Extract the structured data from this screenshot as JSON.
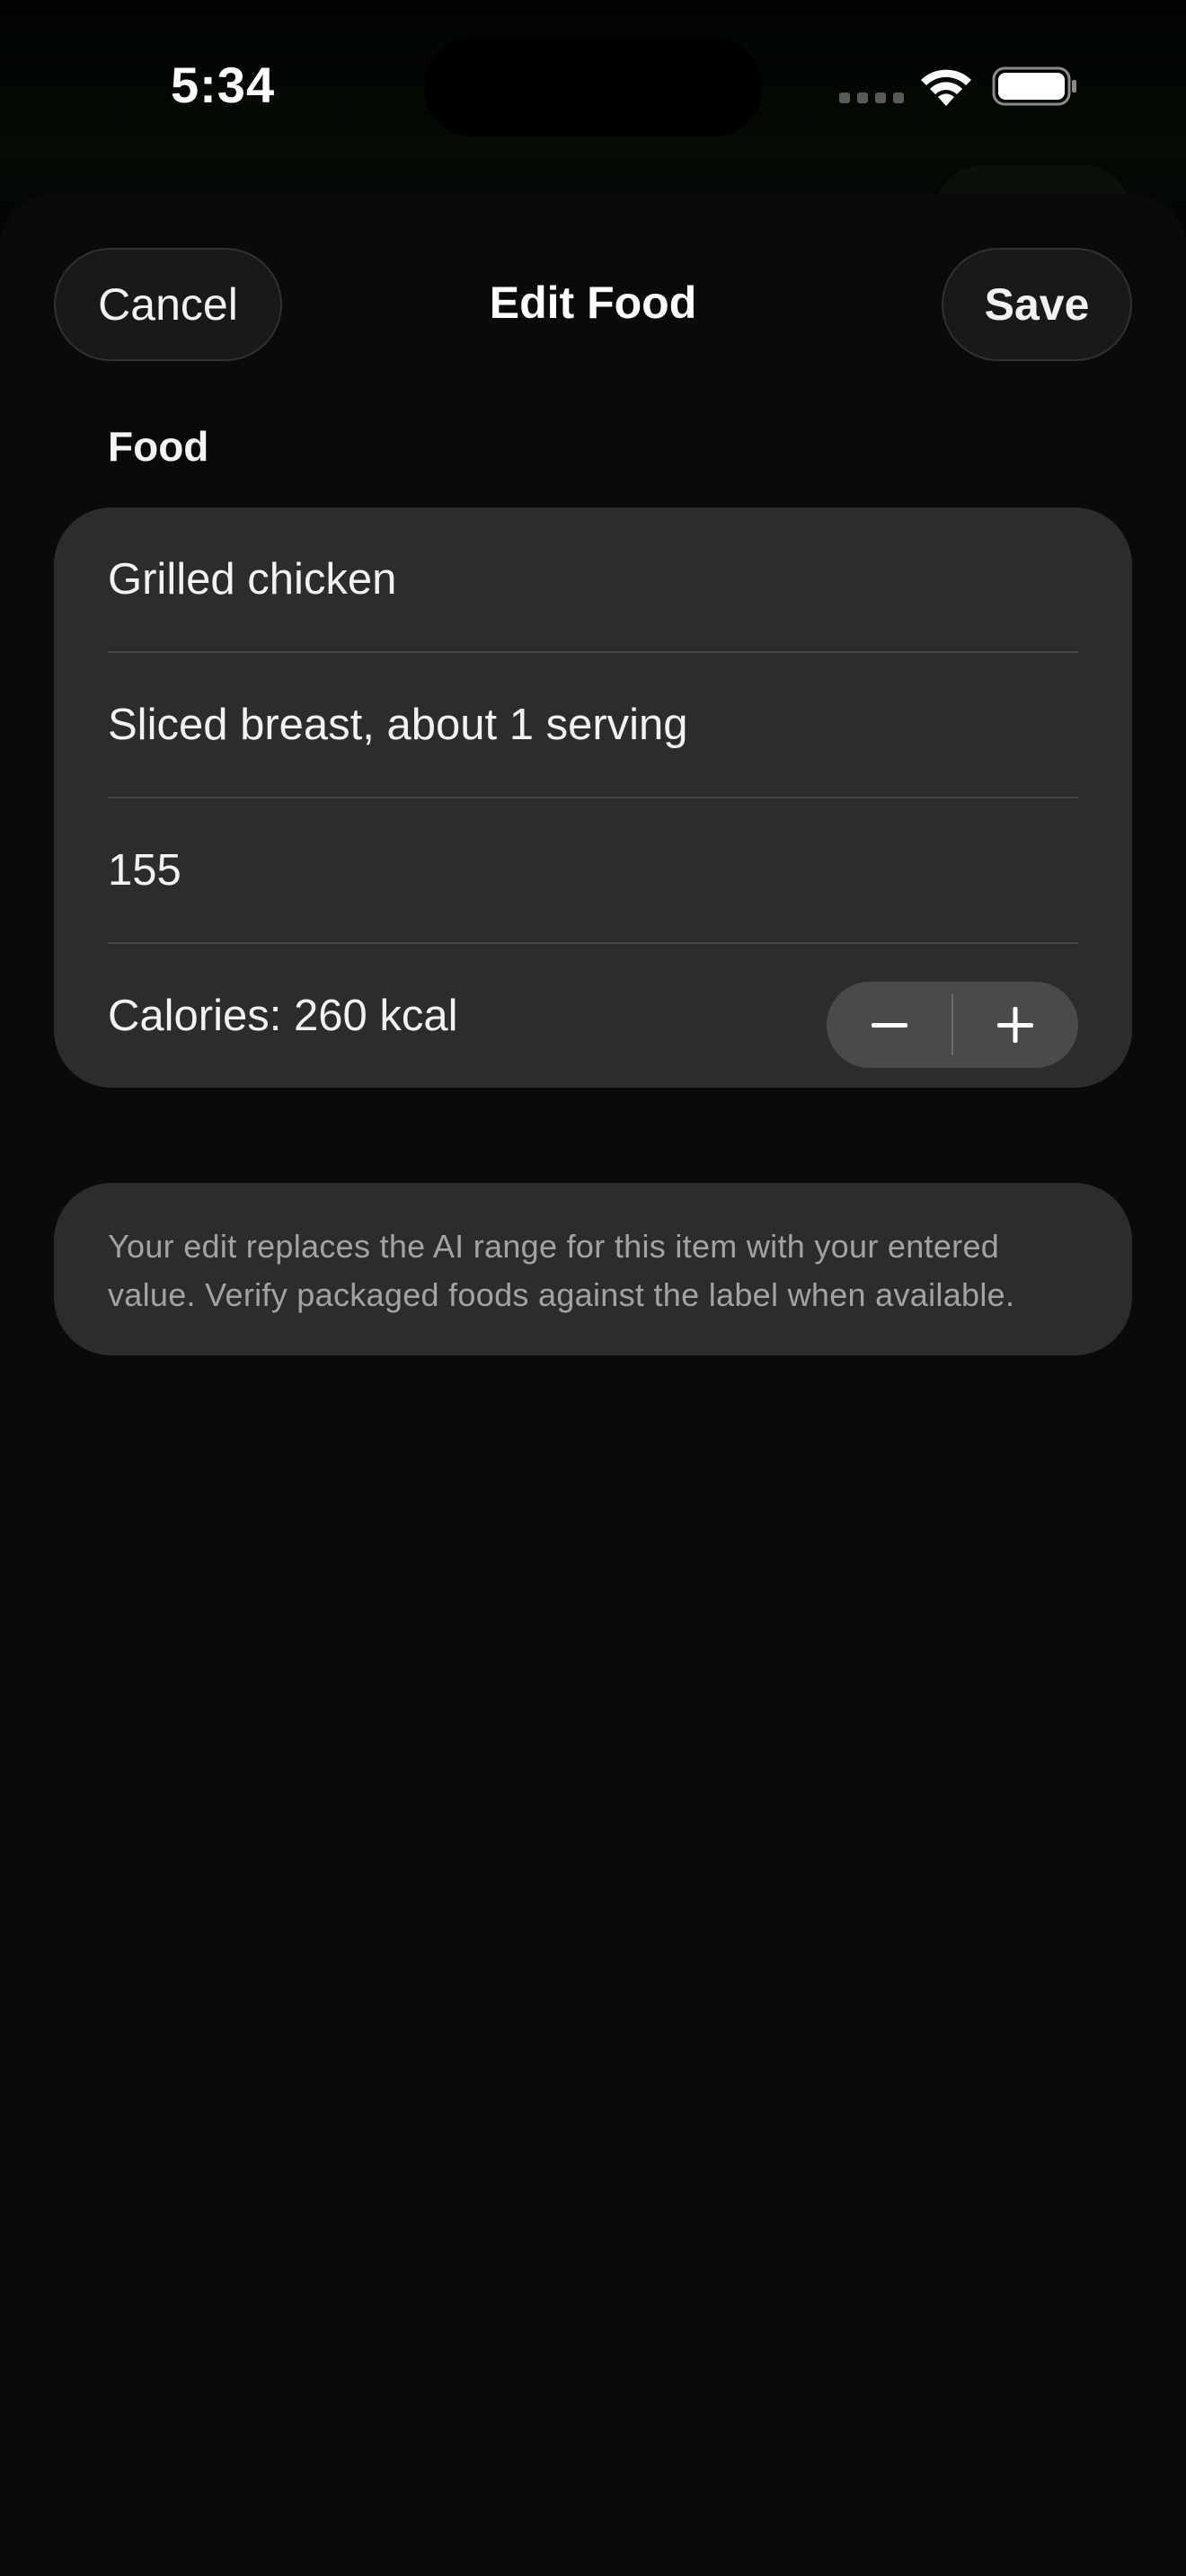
{
  "status_bar": {
    "time": "5:34"
  },
  "sheet": {
    "cancel_label": "Cancel",
    "title": "Edit Food",
    "save_label": "Save"
  },
  "form": {
    "section_header": "Food",
    "name_value": "Grilled chicken",
    "description_value": "Sliced breast, about 1 serving",
    "grams_value": "155",
    "calories_label": "Calories: 260 kcal"
  },
  "info": {
    "text": "Your edit replaces the AI range for this item with your entered value. Verify packaged foods against the label when available."
  },
  "colors": {
    "background": "#0a0a0a",
    "card": "#2c2c2e",
    "stepper": "#4a4a4c",
    "secondary_text": "#a3a3a6"
  },
  "icons": [
    "wifi-icon",
    "battery-icon",
    "minus-icon",
    "plus-icon"
  ]
}
